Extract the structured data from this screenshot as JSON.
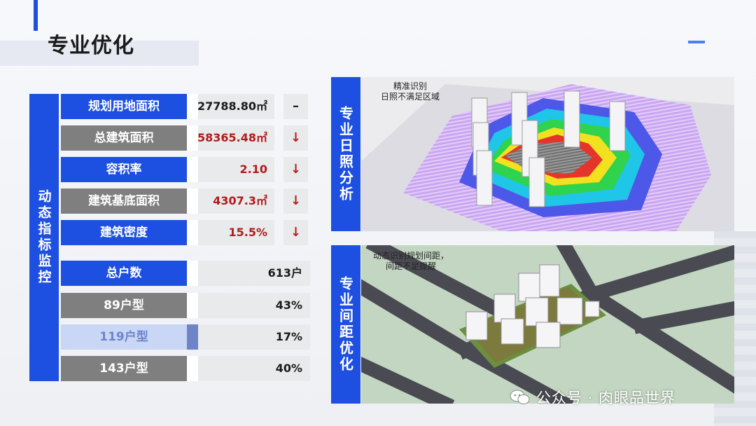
{
  "page": {
    "title": "专业优化"
  },
  "metrics_panel": {
    "side_label": "动态指标监控",
    "rows": [
      {
        "label": "规划用地面积",
        "value": "27788.80㎡",
        "indicator": "–",
        "style": "blue",
        "value_color": "dark"
      },
      {
        "label": "总建筑面积",
        "value": "58365.48㎡",
        "indicator": "↓",
        "style": "gray",
        "value_color": "red"
      },
      {
        "label": "容积率",
        "value": "2.10",
        "indicator": "↓",
        "style": "blue",
        "value_color": "red"
      },
      {
        "label": "建筑基底面积",
        "value": "4307.3㎡",
        "indicator": "↓",
        "style": "gray",
        "value_color": "red"
      },
      {
        "label": "建筑密度",
        "value": "15.5%",
        "indicator": "↓",
        "style": "blue",
        "value_color": "red"
      },
      {
        "label": "总户数",
        "value": "613户",
        "style": "blue"
      },
      {
        "label": "89户型",
        "value": "43%",
        "style": "gray"
      },
      {
        "label": "119户型",
        "value": "17%",
        "style": "light"
      },
      {
        "label": "143户型",
        "value": "40%",
        "style": "gray"
      }
    ]
  },
  "sunlight_panel": {
    "label": "专业日照分析",
    "note_line1": "精准识别",
    "note_line2": "日照不满足区域"
  },
  "spacing_panel": {
    "label": "专业间距优化",
    "note_line1": "动态识别规划间距，",
    "note_line2": "间距不足提醒"
  },
  "watermark": {
    "text": "公众号 · 肉眼品世界",
    "icon": "wechat-icon"
  },
  "colors": {
    "accent": "#1d4fe0",
    "gray_label": "#7f7f7f",
    "light_label": "#c9d6f5",
    "alert_red": "#b01c1c"
  }
}
